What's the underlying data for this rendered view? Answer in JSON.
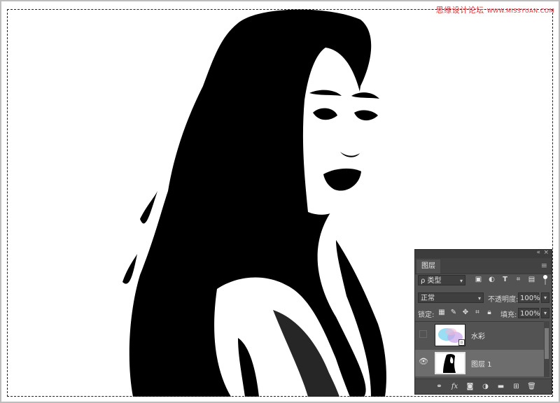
{
  "watermark": {
    "text": "思缘设计论坛",
    "site": "WWW.MISSYUAN.COM"
  },
  "canvas": {
    "subject": "threshold black-and-white portrait of a woman with long dark hair",
    "selection": "marching-ants marquee around full canvas"
  },
  "layers_panel": {
    "tab": "图层",
    "filter": {
      "label": "ρ 类型",
      "icons": [
        "image-filter-icon",
        "adjustment-filter-icon",
        "type-filter-icon",
        "shape-filter-icon",
        "smart-object-filter-icon"
      ]
    },
    "blend_mode": "正常",
    "opacity_label": "不透明度:",
    "opacity_value": "100%",
    "lock_label": "锁定:",
    "fill_label": "填充:",
    "fill_value": "100%",
    "layers": [
      {
        "name": "水彩",
        "visible": false,
        "selected": false
      },
      {
        "name": "图层 1",
        "visible": true,
        "selected": true
      }
    ],
    "bottom_icons": [
      "link-icon",
      "fx-icon",
      "mask-icon",
      "adjustment-icon",
      "folder-icon",
      "new-layer-icon",
      "trash-icon"
    ],
    "fx_label": "fx"
  }
}
